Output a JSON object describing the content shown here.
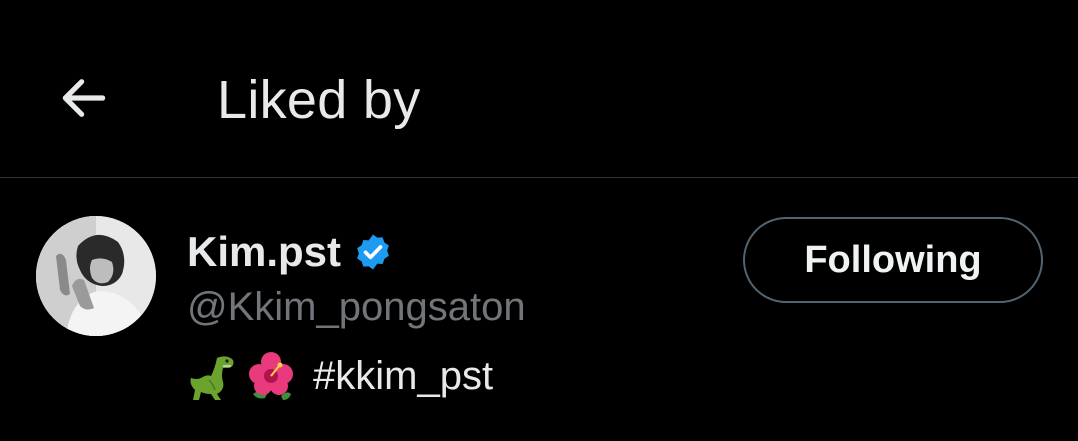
{
  "header": {
    "back_icon": "arrow-left-icon",
    "title": "Liked by"
  },
  "users": [
    {
      "display_name": "Kim.pst",
      "verified": true,
      "verified_icon": "verified-badge-icon",
      "verified_color": "#1d9bf0",
      "handle": "@Kkim_pongsaton",
      "bio_emojis": [
        "dinosaur-emoji",
        "hibiscus-emoji"
      ],
      "bio_text": "#kkim_pst",
      "follow_label": "Following"
    }
  ],
  "colors": {
    "background": "#000000",
    "primary_text": "#e7e9ea",
    "secondary_text": "#71767b",
    "divider": "#2f3336",
    "button_border": "#536471"
  }
}
